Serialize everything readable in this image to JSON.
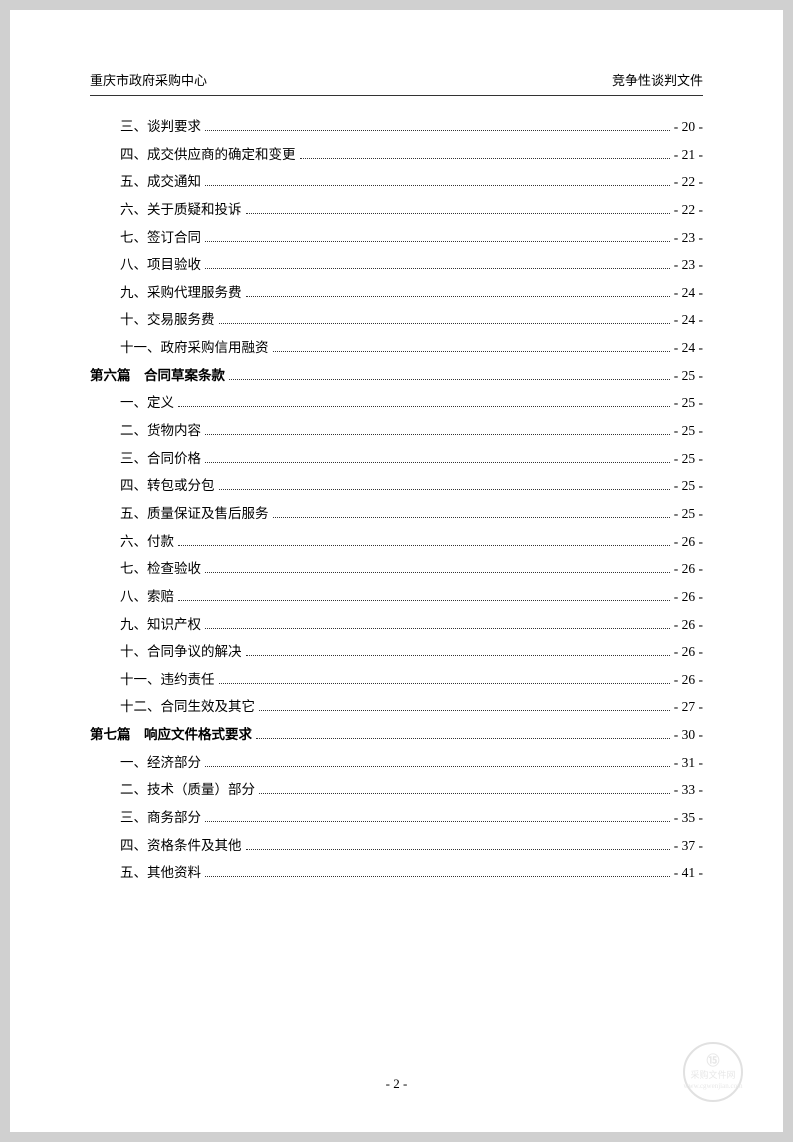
{
  "header": {
    "left": "重庆市政府采购中心",
    "right": "竞争性谈判文件"
  },
  "toc": {
    "items": [
      {
        "indent": 1,
        "bold": false,
        "text": "三、谈判要求",
        "page": "- 20 -"
      },
      {
        "indent": 1,
        "bold": false,
        "text": "四、成交供应商的确定和变更",
        "page": "- 21 -"
      },
      {
        "indent": 1,
        "bold": false,
        "text": "五、成交通知",
        "page": "- 22 -"
      },
      {
        "indent": 1,
        "bold": false,
        "text": "六、关于质疑和投诉",
        "page": "- 22 -"
      },
      {
        "indent": 1,
        "bold": false,
        "text": "七、签订合同",
        "page": "- 23 -"
      },
      {
        "indent": 1,
        "bold": false,
        "text": "八、项目验收",
        "page": "- 23 -"
      },
      {
        "indent": 1,
        "bold": false,
        "text": "九、采购代理服务费",
        "page": "- 24 -"
      },
      {
        "indent": 1,
        "bold": false,
        "text": "十、交易服务费",
        "page": "- 24 -"
      },
      {
        "indent": 1,
        "bold": false,
        "text": "十一、政府采购信用融资",
        "page": "- 24 -"
      },
      {
        "indent": 0,
        "bold": true,
        "text": "第六篇　合同草案条款",
        "page": "- 25 -"
      },
      {
        "indent": 1,
        "bold": false,
        "text": "一、定义",
        "page": "- 25 -"
      },
      {
        "indent": 1,
        "bold": false,
        "text": "二、货物内容",
        "page": "- 25 -"
      },
      {
        "indent": 1,
        "bold": false,
        "text": "三、合同价格",
        "page": "- 25 -"
      },
      {
        "indent": 1,
        "bold": false,
        "text": "四、转包或分包",
        "page": "- 25 -"
      },
      {
        "indent": 1,
        "bold": false,
        "text": "五、质量保证及售后服务",
        "page": "- 25 -"
      },
      {
        "indent": 1,
        "bold": false,
        "text": "六、付款",
        "page": "- 26 -"
      },
      {
        "indent": 1,
        "bold": false,
        "text": "七、检查验收",
        "page": "- 26 -"
      },
      {
        "indent": 1,
        "bold": false,
        "text": "八、索赔",
        "page": "- 26 -"
      },
      {
        "indent": 1,
        "bold": false,
        "text": "九、知识产权",
        "page": "- 26 -"
      },
      {
        "indent": 1,
        "bold": false,
        "text": "十、合同争议的解决",
        "page": "- 26 -"
      },
      {
        "indent": 1,
        "bold": false,
        "text": "十一、违约责任",
        "page": "- 26 -"
      },
      {
        "indent": 1,
        "bold": false,
        "text": "十二、合同生效及其它",
        "page": "- 27 -"
      },
      {
        "indent": 0,
        "bold": true,
        "text": "第七篇　响应文件格式要求",
        "page": "- 30 -"
      },
      {
        "indent": 1,
        "bold": false,
        "text": "一、经济部分",
        "page": "- 31 -"
      },
      {
        "indent": 1,
        "bold": false,
        "text": "二、技术（质量）部分",
        "page": "- 33 -"
      },
      {
        "indent": 1,
        "bold": false,
        "text": "三、商务部分",
        "page": "- 35 -"
      },
      {
        "indent": 1,
        "bold": false,
        "text": "四、资格条件及其他",
        "page": "- 37 -"
      },
      {
        "indent": 1,
        "bold": false,
        "text": "五、其他资料",
        "page": "- 41 -"
      }
    ]
  },
  "footer": {
    "page_label": "- 2 -"
  },
  "watermark": {
    "line1": "采购文件网",
    "line2": "www.cgwenjian.com"
  }
}
